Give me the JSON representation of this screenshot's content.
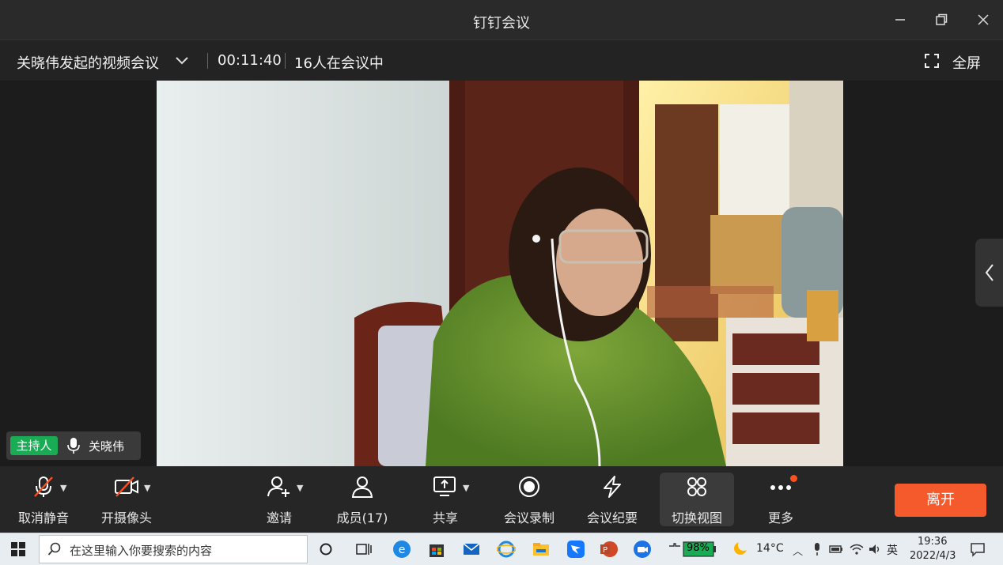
{
  "window": {
    "title": "钉钉会议"
  },
  "meeting": {
    "title": "关晓伟发起的视频会议",
    "elapsed": "00:11:40",
    "participants_text": "16人在会议中",
    "fullscreen_label": "全屏"
  },
  "host_tag": {
    "badge": "主持人",
    "name": "关晓伟"
  },
  "toolbar": {
    "unmute": "取消静音",
    "camera": "开摄像头",
    "invite": "邀请",
    "members": "成员(17)",
    "share": "共享",
    "record": "会议录制",
    "minutes": "会议纪要",
    "switch_view": "切换视图",
    "more": "更多",
    "leave": "离开"
  },
  "colors": {
    "leave": "#f55a2c",
    "host_badge": "#1aab55",
    "more_dot": "#ff4f1f"
  },
  "taskbar": {
    "search_placeholder": "在这里输入你要搜索的内容",
    "battery": "98%",
    "weather": "14°C",
    "ime": "英",
    "time": "19:36",
    "date": "2022/4/3"
  }
}
